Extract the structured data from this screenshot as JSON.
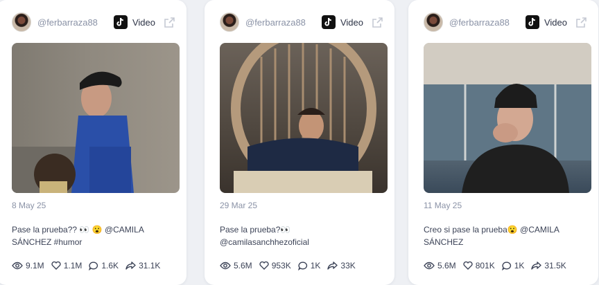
{
  "posts": [
    {
      "username": "@ferbarraza88",
      "platform": "Video",
      "platform_icon": "tiktok-icon",
      "date": "8 May 25",
      "caption": "Pase la prueba?? 👀 😮 @CAMILA SÁNCHEZ #humor",
      "stats": {
        "views": "9.1M",
        "likes": "1.1M",
        "comments": "1.6K",
        "shares": "31.1K"
      }
    },
    {
      "username": "@ferbarraza88",
      "platform": "Video",
      "platform_icon": "tiktok-icon",
      "date": "29 Mar 25",
      "caption": "Pase la prueba?👀 @camilasanchhezoficial",
      "stats": {
        "views": "5.6M",
        "likes": "953K",
        "comments": "1K",
        "shares": "33K"
      }
    },
    {
      "username": "@ferbarraza88",
      "platform": "Video",
      "platform_icon": "tiktok-icon",
      "date": "11 May 25",
      "caption": "Creo si pase la prueba😮 @CAMILA SÁNCHEZ",
      "stats": {
        "views": "5.6M",
        "likes": "801K",
        "comments": "1K",
        "shares": "31.5K"
      }
    }
  ],
  "colors": {
    "background": "#eef0f4",
    "card": "#ffffff",
    "muted_text": "#8a92a6",
    "body_text": "#3b4256"
  }
}
